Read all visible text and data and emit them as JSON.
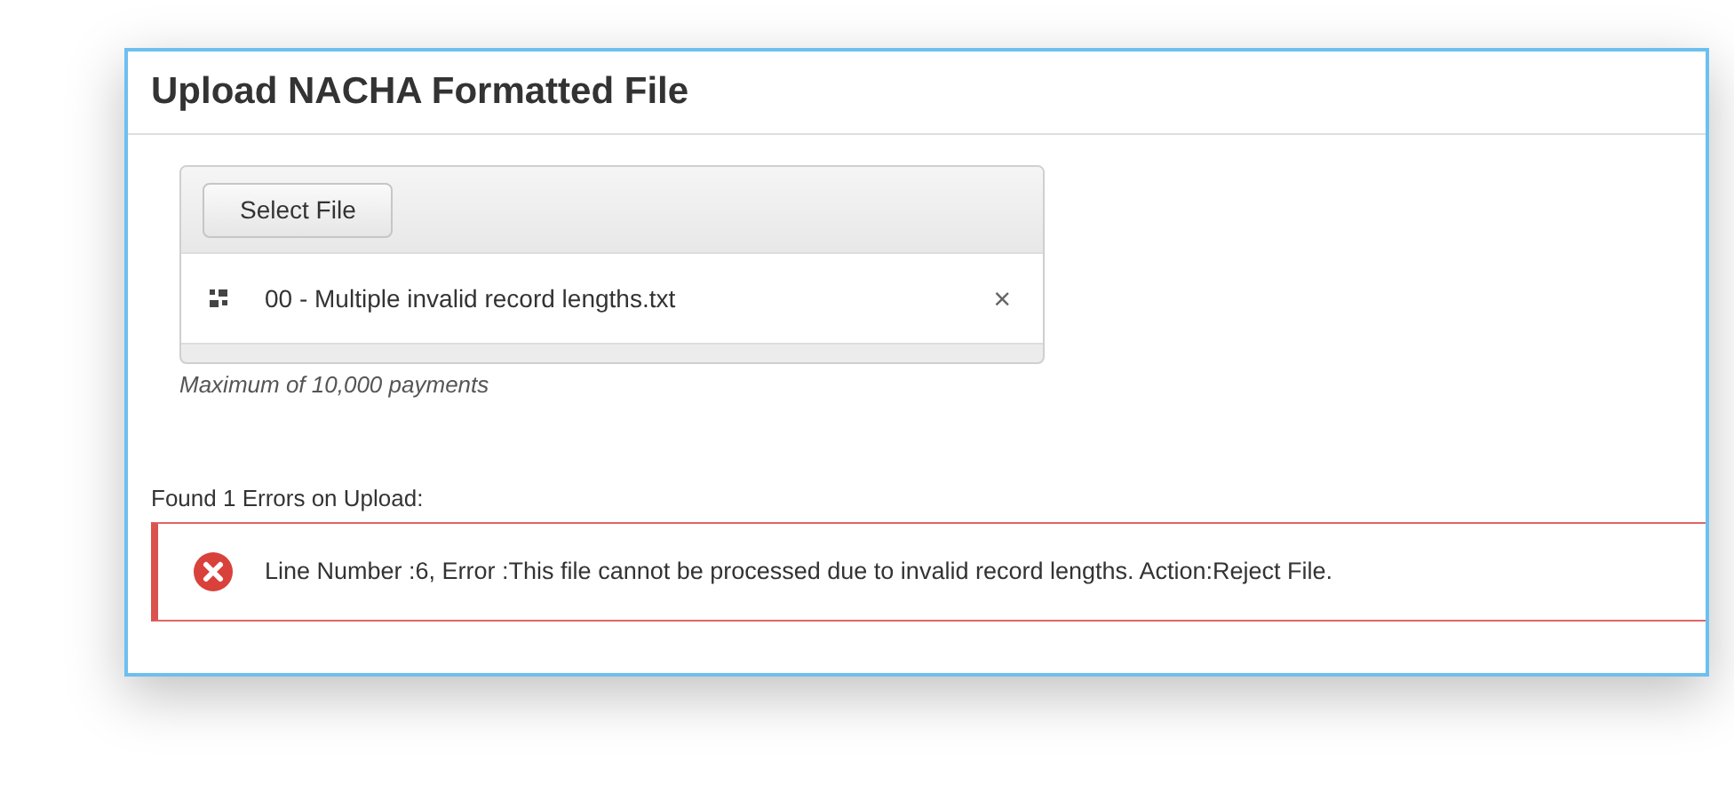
{
  "panel": {
    "title": "Upload NACHA Formatted File"
  },
  "upload": {
    "button": "Select File",
    "files": [
      {
        "name": "00 - Multiple invalid record lengths.txt",
        "remove": "×"
      }
    ],
    "note": "Maximum of 10,000 payments"
  },
  "errors": {
    "heading": "Found 1 Errors on Upload:",
    "items": [
      {
        "message": "Line Number :6, Error :This file cannot be processed due to invalid record lengths. Action:Reject File."
      }
    ]
  }
}
